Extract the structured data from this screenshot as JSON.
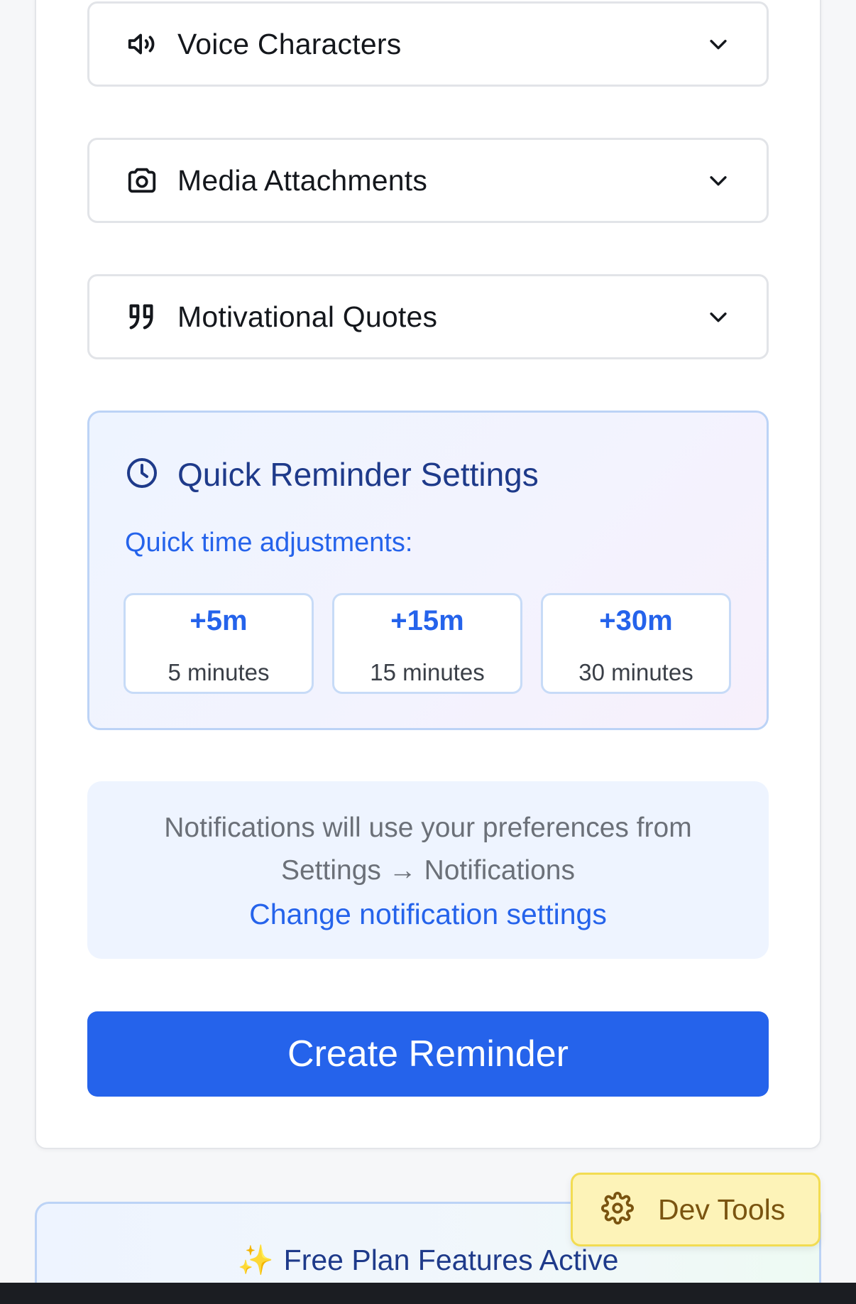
{
  "accordions": [
    {
      "label": "Voice Characters",
      "icon": "speaker-icon"
    },
    {
      "label": "Media Attachments",
      "icon": "camera-icon"
    },
    {
      "label": "Motivational Quotes",
      "icon": "quote-icon"
    }
  ],
  "quick_reminder": {
    "title": "Quick Reminder Settings",
    "subtitle": "Quick time adjustments:",
    "chips": [
      {
        "value": "+5m",
        "caption": "5 minutes"
      },
      {
        "value": "+15m",
        "caption": "15 minutes"
      },
      {
        "value": "+30m",
        "caption": "30 minutes"
      }
    ]
  },
  "notice": {
    "line1": "Notifications will use your preferences from",
    "line2": "Settings → Notifications",
    "link": "Change notification settings"
  },
  "create_button": "Create Reminder",
  "plan_banner": {
    "sparkle": "✨",
    "text": "Free Plan Features Active"
  },
  "dev_tools": {
    "label": "Dev Tools"
  },
  "colors": {
    "primary": "#2563eb",
    "heading_blue": "#1e3a8a",
    "dev_tools_bg": "#fdf3b8"
  }
}
